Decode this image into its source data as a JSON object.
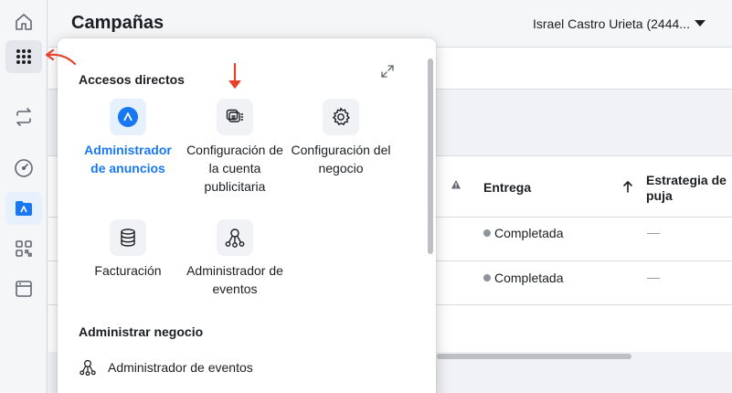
{
  "header": {
    "title": "Campañas",
    "account": "Israel Castro Urieta (2444..."
  },
  "table": {
    "columns": [
      "Entrega",
      "Estrategia de puja"
    ],
    "rows": [
      {
        "status": "Completada",
        "bid": "—"
      },
      {
        "status": "Completada",
        "bid": "—"
      }
    ]
  },
  "panel": {
    "shortcuts_title": "Accesos directos",
    "shortcuts": [
      {
        "label": "Administrador de anuncios",
        "icon": "ads-manager-icon"
      },
      {
        "label": "Configuración de la cuenta publicitaria",
        "icon": "ad-account-settings-icon"
      },
      {
        "label": "Configuración del negocio",
        "icon": "gear-icon"
      },
      {
        "label": "Facturación",
        "icon": "billing-icon"
      },
      {
        "label": "Administrador de eventos",
        "icon": "events-manager-icon"
      }
    ],
    "manage_title": "Administrar negocio",
    "manage_items": [
      {
        "label": "Administrador de eventos",
        "icon": "events-manager-icon"
      }
    ]
  },
  "colors": {
    "accent": "#1877f2",
    "annotation": "#e8412a"
  }
}
